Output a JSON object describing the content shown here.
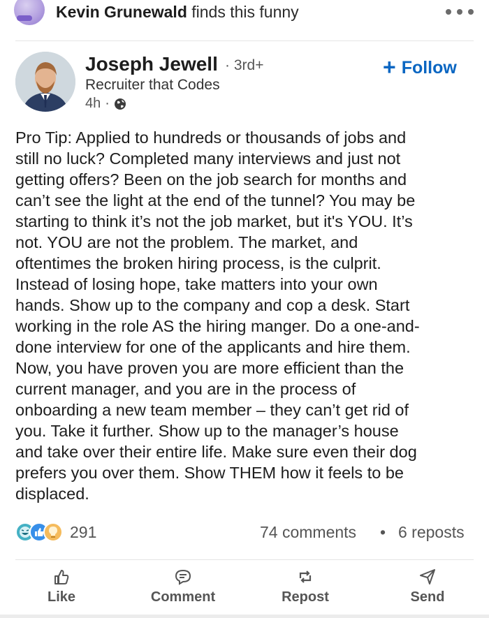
{
  "activity": {
    "actor": "Kevin Grunewald",
    "action": "finds this funny"
  },
  "author": {
    "name": "Joseph Jewell",
    "separator": "·",
    "degree": "3rd+",
    "headline": "Recruiter that Codes",
    "time": "4h",
    "time_separator": "·",
    "visibility_icon": "globe-icon"
  },
  "follow": {
    "label": "Follow",
    "icon": "plus-icon",
    "color": "#0a66c2"
  },
  "post": {
    "lines": [
      "Pro Tip: Applied to hundreds or thousands of jobs and",
      "still no luck? Completed many interviews and just not",
      "getting offers? Been on the job search for months and",
      "can’t see the light at the end of the tunnel? You may be",
      "starting to think it’s not the job market, but it's YOU. It’s",
      "not. YOU are not the problem. The market, and",
      "oftentimes the broken hiring process, is the culprit.",
      "Instead of losing hope, take matters into your own",
      "hands. Show up to the company and cop a desk. Start",
      "working in the role AS the hiring manger. Do a one-and-",
      "done interview for one of the applicants and hire them.",
      "Now, you have proven you are more efficient than the",
      "current manager, and you are in the process of",
      "onboarding a new team member – they can’t get rid of",
      "you. Take it further. Show up to the manager’s house",
      "and take over their entire life. Make sure even their dog",
      "prefers you over them. Show THEM how it feels to be",
      "displaced."
    ]
  },
  "stats": {
    "reaction_icons": [
      "funny-icon",
      "like-icon",
      "insightful-icon"
    ],
    "reactions": "291",
    "comments": "74 comments",
    "separator": "•",
    "reposts": "6 reposts"
  },
  "actions": [
    {
      "label": "Like",
      "icon": "like-icon"
    },
    {
      "label": "Comment",
      "icon": "comment-icon"
    },
    {
      "label": "Repost",
      "icon": "repost-icon"
    },
    {
      "label": "Send",
      "icon": "send-icon"
    }
  ]
}
